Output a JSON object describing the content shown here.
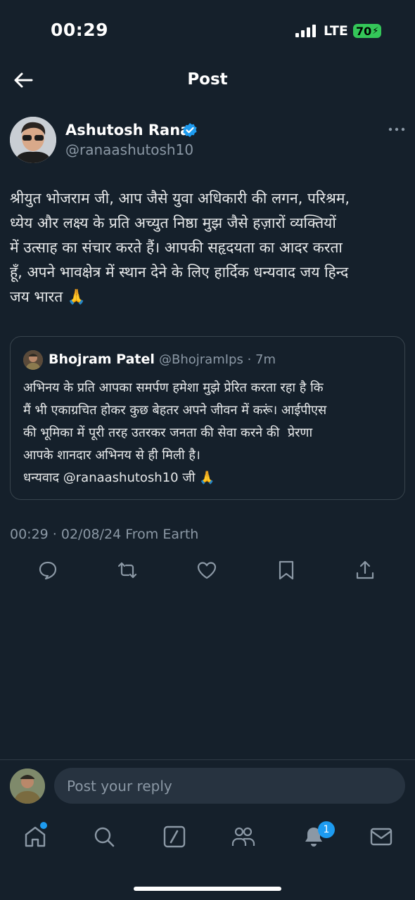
{
  "status_bar": {
    "time": "00:29",
    "network": "LTE",
    "battery": "70"
  },
  "header": {
    "title": "Post",
    "back_icon": "arrow-left-icon"
  },
  "post": {
    "author_name": "Ashutosh Rana",
    "author_handle": "@ranaashutosh10",
    "verified": true,
    "text": "श्रीयुत भोजराम जी, आप जैसे युवा अधिकारी की लगन, परिश्रम,\nध्येय और लक्ष्य के प्रति अच्युत निष्ठा मुझ जैसे हज़ारों व्यक्तियों\nमें उत्साह का संचार करते हैं। आपकी सहृदयता का आदर करता\nहूँ, अपने भावक्षेत्र में स्थान देने के लिए हार्दिक धन्यवाद जय हिन्द\nजय भारत 🙏",
    "meta": "00:29 · 02/08/24 From Earth"
  },
  "quote": {
    "author_name": "Bhojram Patel",
    "author_handle": "@BhojramIps · 7m",
    "text": "अभिनय के प्रति आपका समर्पण हमेशा मुझे प्रेरित करता रहा है कि\nमैं भी एकाग्रचित होकर कुछ बेहतर अपने जीवन में करूं। आईपीएस\nकी भूमिका में पूरी तरह उतरकर जनता की सेवा करने की  प्रेरणा\nआपके शानदार अभिनय से ही मिली है।\nधन्यवाद @ranaashutosh10 जी 🙏"
  },
  "actions": [
    "reply-icon",
    "repost-icon",
    "like-icon",
    "bookmark-icon",
    "share-icon"
  ],
  "reply_bar": {
    "placeholder": "Post your reply"
  },
  "bottom_nav": {
    "items": [
      "home-icon",
      "search-icon",
      "grok-icon",
      "communities-icon",
      "notifications-icon",
      "messages-icon"
    ],
    "notification_count": "1"
  },
  "colors": {
    "background": "#15202b",
    "accent": "#1d9bf0",
    "muted": "#8b98a5",
    "battery": "#34c759"
  }
}
